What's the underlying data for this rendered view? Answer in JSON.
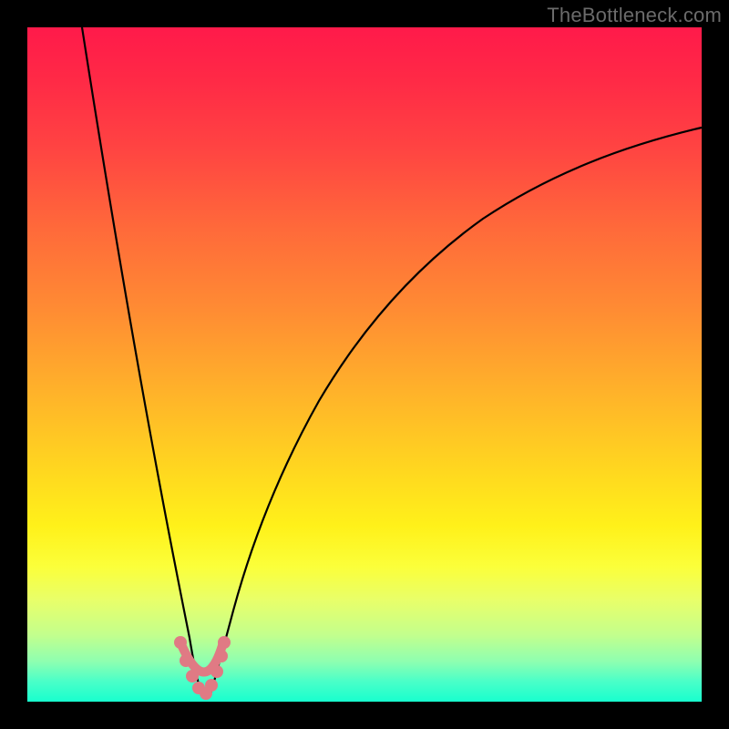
{
  "watermark": "TheBottleneck.com",
  "chart_data": {
    "type": "line",
    "title": "",
    "xlabel": "",
    "ylabel": "",
    "xlim": [
      0,
      100
    ],
    "ylim": [
      0,
      100
    ],
    "grid": false,
    "legend": false,
    "note": "Values estimated from pixel positions; no numeric axes are rendered in the image.",
    "series": [
      {
        "name": "left-curve",
        "x": [
          8,
          10,
          12,
          14,
          16,
          18,
          20,
          22,
          23,
          24,
          25
        ],
        "y": [
          100,
          84,
          70,
          57,
          45,
          34,
          23,
          14,
          9,
          5,
          1
        ]
      },
      {
        "name": "right-curve",
        "x": [
          27,
          28,
          30,
          33,
          37,
          42,
          48,
          55,
          63,
          72,
          82,
          92,
          100
        ],
        "y": [
          1,
          6,
          14,
          25,
          36,
          46,
          55,
          62,
          68,
          73,
          78,
          82,
          85
        ]
      },
      {
        "name": "markers",
        "x": [
          22.5,
          23.3,
          24.0,
          24.8,
          25.5,
          26.3,
          27.0,
          27.8,
          28.5
        ],
        "y": [
          9,
          6,
          3,
          1.5,
          1,
          1.5,
          3,
          6,
          9
        ]
      }
    ]
  }
}
